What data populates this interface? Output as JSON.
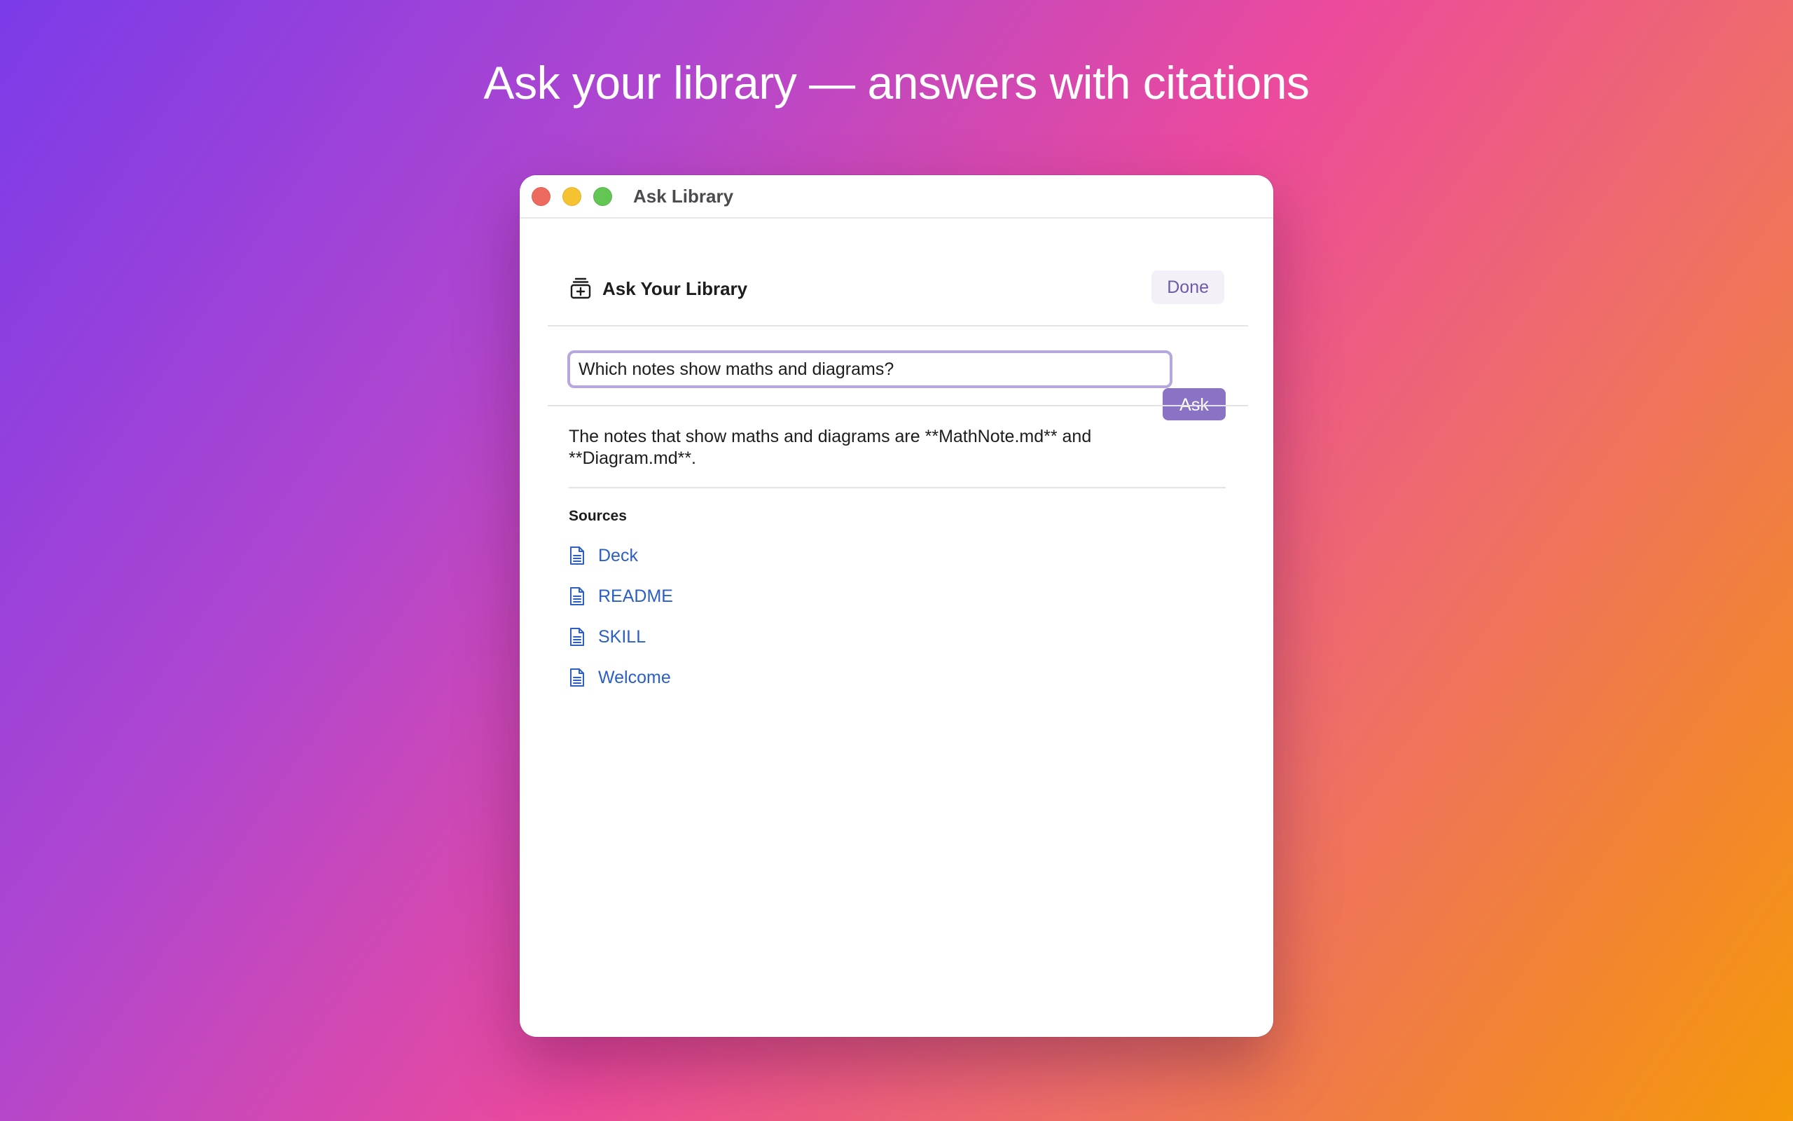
{
  "headline": "Ask your library — answers with citations",
  "window": {
    "title": "Ask Library"
  },
  "header": {
    "title": "Ask Your Library",
    "done_label": "Done",
    "icon": "library-add-icon"
  },
  "query": {
    "value": "Which notes show maths and diagrams?",
    "ask_label": "Ask"
  },
  "answer": {
    "text": "The notes that show maths and diagrams are **MathNote.md** and **Diagram.md**."
  },
  "sources": {
    "heading": "Sources",
    "items": [
      {
        "label": "Deck",
        "icon": "document-icon"
      },
      {
        "label": "README",
        "icon": "document-icon"
      },
      {
        "label": "SKILL",
        "icon": "document-icon"
      },
      {
        "label": "Welcome",
        "icon": "document-icon"
      }
    ]
  },
  "colors": {
    "accent": "#8a72c4",
    "link": "#2b5fc4",
    "traffic_close": "#ed6a5e",
    "traffic_minimize": "#f5c232",
    "traffic_zoom": "#62c554"
  }
}
